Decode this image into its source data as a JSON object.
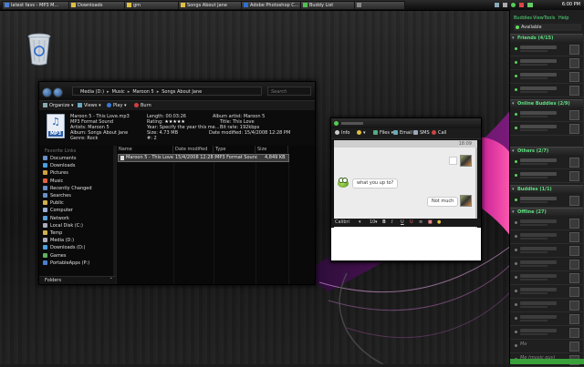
{
  "taskbar": {
    "tasks": [
      {
        "label": "latest favs - MP3 M...",
        "color": "#4a7fd4"
      },
      {
        "label": "Downloads",
        "color": "#e0c040"
      },
      {
        "label": "gm",
        "color": "#e0c040"
      },
      {
        "label": "Songs About Jane",
        "color": "#e0c040"
      },
      {
        "label": "Adobe Photoshop C...",
        "color": "#2f6fd0"
      },
      {
        "label": "Buddy List",
        "color": "#50c050"
      },
      {
        "label": "",
        "color": "#888888"
      }
    ],
    "clock": "6:00 PM"
  },
  "explorer": {
    "breadcrumb": [
      "Media (D:)",
      "Music",
      "Maroon 5",
      "Songs About Jane"
    ],
    "search_placeholder": "Search",
    "toolbar": {
      "organize": "Organize",
      "views": "Views",
      "play": "Play",
      "burn": "Burn"
    },
    "details": {
      "filename": "Maroon 5 - This Love.mp3",
      "filetype": "MP3 Format Sound",
      "artists": "Artists: Maroon 5",
      "album": "Album: Songs About Jane",
      "genre": "Genre: Rock",
      "length": "Length: 00:03:26",
      "rating": "Rating:",
      "rating_stars": "★★★★★",
      "year": "Year: Specify the year this me...",
      "size": "Size: 4.73 MB",
      "track": "#: 2",
      "album_artist": "Album artist: Maroon 5",
      "title": "Title: This Love",
      "bitrate": "Bit rate: 192kbps",
      "date_modified": "Date modified: 15/4/2008 12:28 PM"
    },
    "nav_heading": "Favorite Links",
    "nav_items": [
      {
        "label": "Documents",
        "color": "#6a8fc8"
      },
      {
        "label": "Downloads",
        "color": "#4aa0e0"
      },
      {
        "label": "Pictures",
        "color": "#d0a040"
      },
      {
        "label": "Music",
        "color": "#e06040"
      },
      {
        "label": "Recently Changed",
        "color": "#6a8fc8"
      },
      {
        "label": "Searches",
        "color": "#6a8fc8"
      },
      {
        "label": "Public",
        "color": "#d0b050"
      },
      {
        "label": "Computer",
        "color": "#9ab0d0"
      },
      {
        "label": "Network",
        "color": "#5aa0d8"
      },
      {
        "label": "Local Disk (C:)",
        "color": "#aab"
      },
      {
        "label": "Temp",
        "color": "#d0b050"
      },
      {
        "label": "Media (D:)",
        "color": "#aab"
      },
      {
        "label": "Downloads (D:)",
        "color": "#4aa0e0"
      },
      {
        "label": "Games",
        "color": "#60b060"
      },
      {
        "label": "PortableApps (P:)",
        "color": "#4a7fd4"
      }
    ],
    "folders_label": "Folders",
    "columns": [
      "Name",
      "Date modified",
      "Type",
      "Size"
    ],
    "rows": [
      {
        "name": "Maroon 5 - This Love...",
        "date": "15/4/2008 12:28 PM",
        "type": "MP3 Format Sound",
        "size": "4,849 KB"
      }
    ]
  },
  "chat": {
    "toolbar": [
      "Info",
      "",
      "Files",
      "Email",
      "SMS",
      "Call"
    ],
    "time": "18:09",
    "messages": [
      {
        "from": "buddy",
        "text": "what you up to?"
      },
      {
        "from": "me",
        "text": "Not much"
      }
    ],
    "font_label": "Calibri",
    "font_size": "10",
    "format_buttons": [
      "B",
      "I",
      "U",
      "U"
    ]
  },
  "buddylist": {
    "menu": [
      "Buddies",
      "View",
      "Tools",
      "Help"
    ],
    "status": "Available",
    "groups": [
      {
        "label": "Friends (4/15)"
      },
      {
        "label": "Online Buddies (2/9)"
      },
      {
        "label": "Others (2/7)"
      },
      {
        "label": "Buddies (1/1)"
      },
      {
        "label": "Offline (27)"
      }
    ],
    "offline_labels": [
      "Me",
      "Me (music guy)"
    ]
  }
}
